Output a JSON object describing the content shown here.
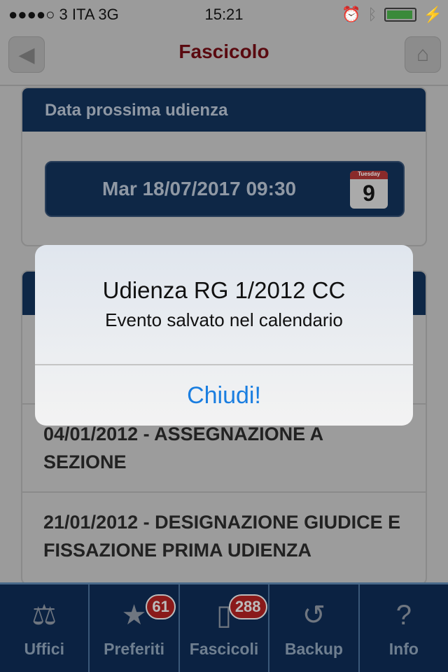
{
  "status": {
    "carrier": "●●●●○ 3 ITA   3G",
    "time": "15:21",
    "battery_level": 0.95
  },
  "nav": {
    "title": "Fascicolo",
    "back_icon": "back-arrow-icon",
    "home_icon": "home-icon"
  },
  "card1": {
    "header": "Data prossima udienza",
    "date": "Mar 18/07/2017 09:30",
    "calendar_day": "9",
    "calendar_weekday": "Tuesday"
  },
  "rows": [
    "04/01/2012 - ASSEGNAZIONE A SEZIONE",
    "21/01/2012 - DESIGNAZIONE GIUDICE E FISSAZIONE PRIMA UDIENZA"
  ],
  "tabs": [
    {
      "label": "Uffici"
    },
    {
      "label": "Preferiti",
      "badge": "61"
    },
    {
      "label": "Fascicoli",
      "badge": "288"
    },
    {
      "label": "Backup"
    },
    {
      "label": "Info"
    }
  ],
  "alert": {
    "title": "Udienza RG 1/2012 CC",
    "message": "Evento salvato nel calendario",
    "button": "Chiudi!"
  },
  "colors": {
    "navy": "#0e2746",
    "title": "#5a0a10",
    "alert_button": "#1a7ee0",
    "badge": "#8a1a1a"
  }
}
